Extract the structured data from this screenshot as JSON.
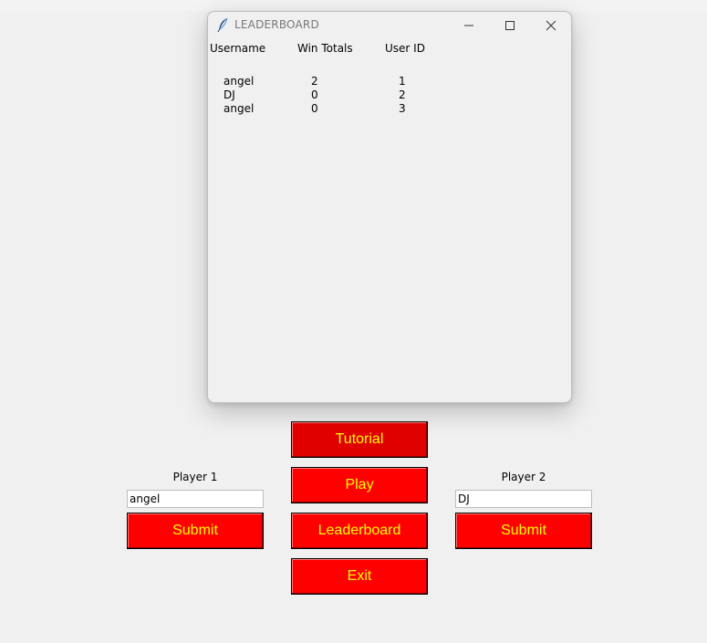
{
  "leaderboard_window": {
    "title": "LEADERBOARD",
    "columns": [
      "Username",
      "Win Totals",
      "User ID"
    ],
    "rows": [
      {
        "username": "angel",
        "wins": "2",
        "user_id": "1"
      },
      {
        "username": "DJ",
        "wins": "0",
        "user_id": "2"
      },
      {
        "username": "angel",
        "wins": "0",
        "user_id": "3"
      }
    ]
  },
  "main": {
    "buttons": {
      "tutorial": "Tutorial",
      "play": "Play",
      "leaderboard": "Leaderboard",
      "exit": "Exit"
    },
    "player1": {
      "label": "Player 1",
      "value": "angel",
      "submit": "Submit"
    },
    "player2": {
      "label": "Player 2",
      "value": "DJ",
      "submit": "Submit"
    }
  },
  "colors": {
    "button_bg": "#ff0000",
    "button_text": "#ffff00",
    "window_bg": "#f0f0f0"
  },
  "icons": [
    "feather-icon",
    "minimize-icon",
    "maximize-icon",
    "close-icon"
  ]
}
